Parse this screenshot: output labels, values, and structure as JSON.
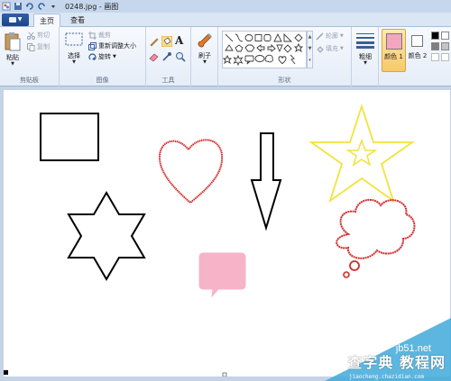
{
  "window": {
    "title": "0248.jpg - 画图"
  },
  "tabs": {
    "home": "主页",
    "view": "查看"
  },
  "clipboard": {
    "paste": "粘贴",
    "cut": "剪切",
    "copy": "复制",
    "group": "剪贴板"
  },
  "image": {
    "select": "选择",
    "crop": "裁剪",
    "resize": "重新调整大小",
    "rotate": "旋转",
    "group": "图像"
  },
  "tools": {
    "group": "工具"
  },
  "brushes": {
    "label": "刷子"
  },
  "shapes": {
    "outline": "轮廓",
    "fill": "填充",
    "group": "形状"
  },
  "size": {
    "label": "粗细"
  },
  "colors": {
    "color1": "颜色 1",
    "color2": "颜色 2",
    "color1_value": "#f4a6bf",
    "color2_value": "#ffffff"
  },
  "watermark": {
    "site": "jb51.net",
    "main": "查字典 教程网",
    "url": "jiaocheng.chazidian.com"
  },
  "canvas_shapes": {
    "rectangle": "#000000",
    "heart": "#d42a2a",
    "arrow": "#000000",
    "star": "#f2e33a",
    "hexagram": "#000000",
    "callout": "#f7b3c8",
    "cloud": "#d42a2a"
  }
}
